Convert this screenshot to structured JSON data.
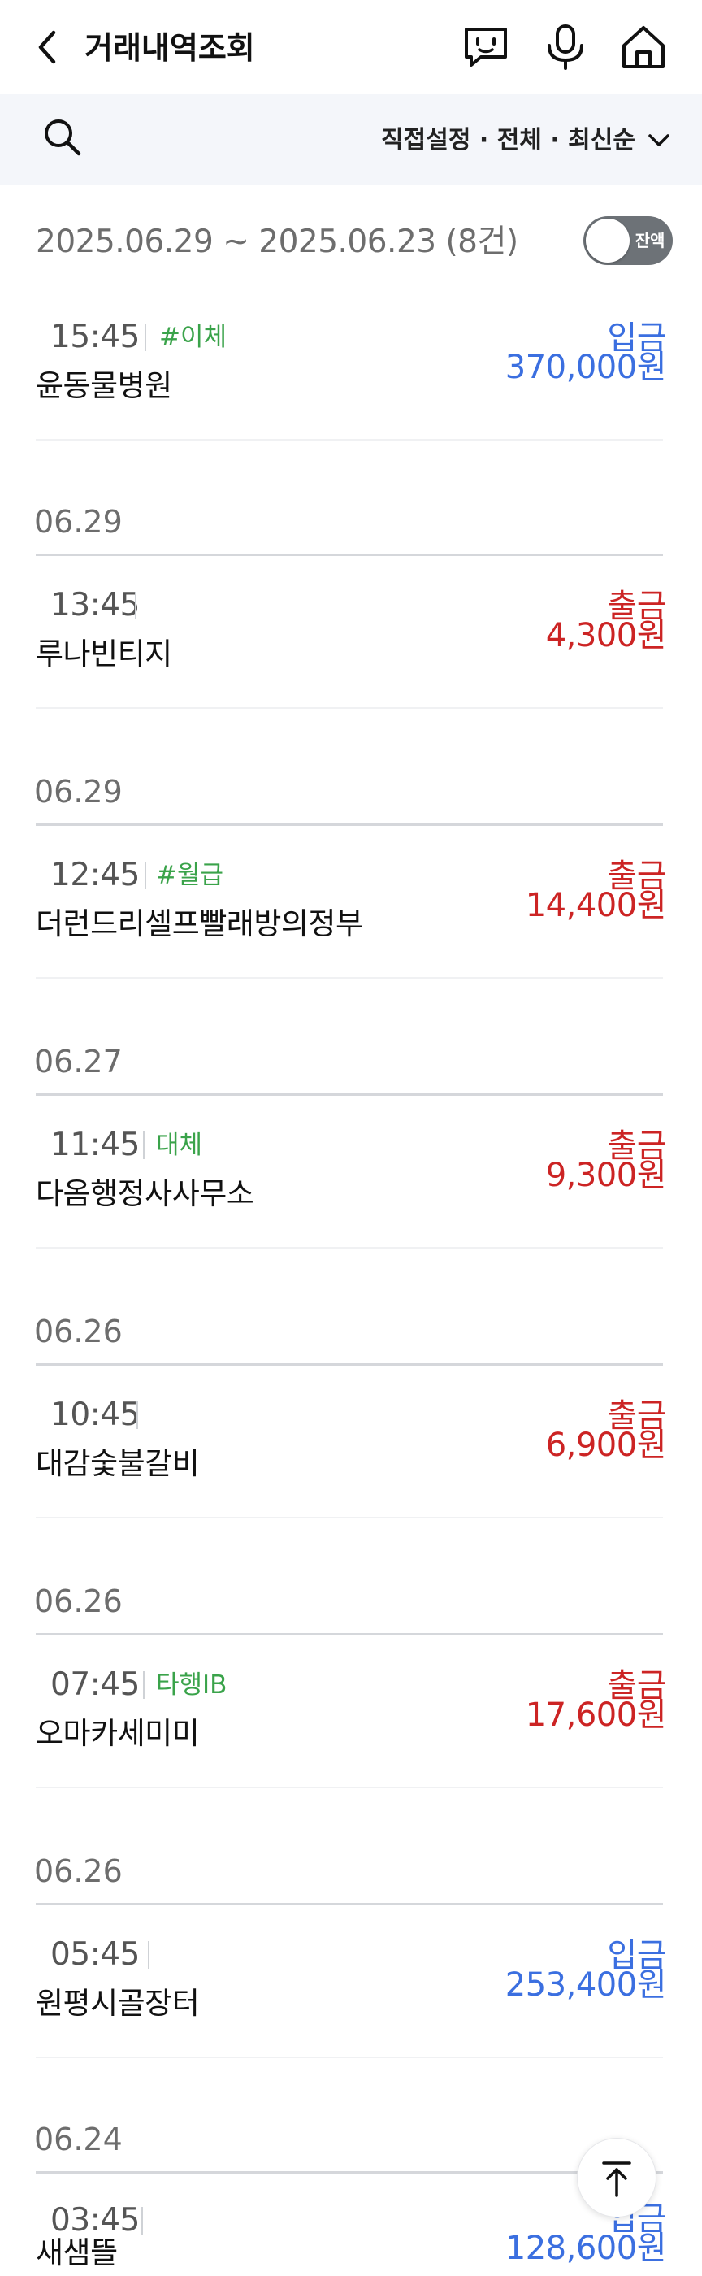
{
  "header": {
    "title": "거래내역조회"
  },
  "filter": {
    "label": "직접설정 · 전체 · 최신순"
  },
  "summary": {
    "range": "2025.06.29 ~ 2025.06.23 (8건)",
    "balance_toggle": "잔액",
    "balance_toggle_on": false
  },
  "colors": {
    "deposit": "#3b6fe0",
    "withdraw": "#cc2424",
    "tag": "#3aa34a"
  },
  "icons": {
    "back": "chevron-left-icon",
    "chatbot": "chatbot-icon",
    "voice": "microphone-icon",
    "home": "home-icon",
    "search": "search-icon",
    "filter": "chevron-down-icon",
    "scroll_top": "arrow-up-icon"
  },
  "dates": [
    "06.29",
    "06.29",
    "06.27",
    "06.26",
    "06.26",
    "06.26",
    "06.24"
  ],
  "transactions": [
    {
      "time": "15:45",
      "tag": "#이체",
      "name": "윤동물병원",
      "type": "입금",
      "amount": "370,000원"
    },
    {
      "time": "13:45",
      "tag": "",
      "name": "루나빈티지",
      "type": "출금",
      "amount": "4,300원"
    },
    {
      "time": "12:45",
      "tag": "#월급",
      "name": "더런드리셀프빨래방의정부",
      "type": "출금",
      "amount": "14,400원"
    },
    {
      "time": "11:45",
      "tag": "대체",
      "name": "다옴행정사사무소",
      "type": "출금",
      "amount": "9,300원"
    },
    {
      "time": "10:45",
      "tag": "",
      "name": "대감숯불갈비",
      "type": "출금",
      "amount": "6,900원"
    },
    {
      "time": "07:45",
      "tag": "타행IB",
      "name": "오마카세미미",
      "type": "출금",
      "amount": "17,600원"
    },
    {
      "time": "05:45",
      "tag": "",
      "name": "원평시골장터",
      "type": "입금",
      "amount": "253,400원"
    },
    {
      "time": "03:45",
      "tag": "",
      "name": "새샘뜰",
      "type": "입금",
      "amount": "128,600원"
    }
  ]
}
